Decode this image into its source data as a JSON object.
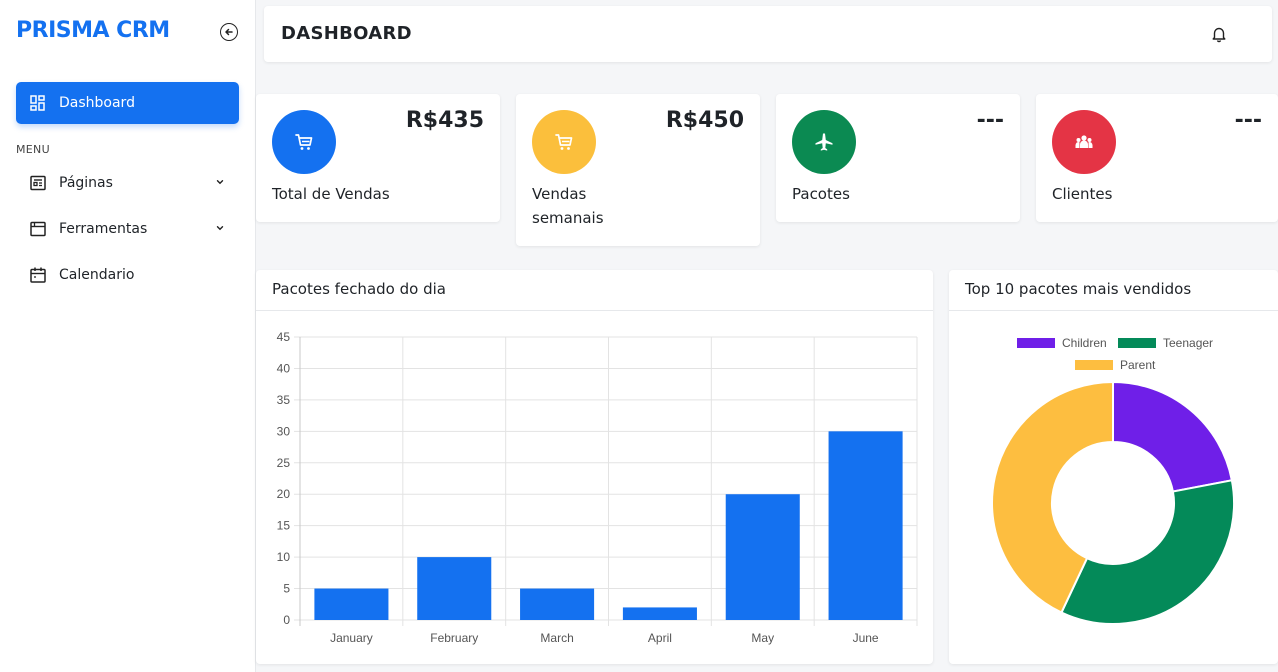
{
  "app": {
    "brand": "PRISMA CRM"
  },
  "sidebar": {
    "active": {
      "label": "Dashboard",
      "icon": "dashboard-icon"
    },
    "menu_header": "MENU",
    "items": [
      {
        "label": "Páginas",
        "icon": "pages-icon",
        "has_submenu": true
      },
      {
        "label": "Ferramentas",
        "icon": "window-icon",
        "has_submenu": true
      },
      {
        "label": "Calendario",
        "icon": "calendar-icon",
        "has_submenu": false
      }
    ]
  },
  "header": {
    "title": "DASHBOARD"
  },
  "cards": [
    {
      "label": "Total de Vendas",
      "value": "R$435",
      "icon": "cart-icon",
      "color": "#1471f0"
    },
    {
      "label": "Vendas semanais",
      "value": "R$450",
      "icon": "cart-icon",
      "color": "#fbbf3c"
    },
    {
      "label": "Pacotes",
      "value": "---",
      "icon": "airplane-icon",
      "color": "#0b8a52"
    },
    {
      "label": "Clientes",
      "value": "---",
      "icon": "users-icon",
      "color": "#e43445"
    }
  ],
  "bar_panel": {
    "title": "Pacotes fechado do dia"
  },
  "pie_panel": {
    "title": "Top 10 pacotes mais vendidos"
  },
  "colors": {
    "primary": "#1471f0",
    "children": "#6f1fe8",
    "teenager": "#048a59",
    "parent": "#fdbe40"
  },
  "chart_data": [
    {
      "type": "bar",
      "categories": [
        "January",
        "February",
        "March",
        "April",
        "May",
        "June"
      ],
      "values": [
        5,
        10,
        5,
        2,
        20,
        30
      ],
      "ylim": [
        0,
        45
      ],
      "yticks": [
        0,
        5,
        10,
        15,
        20,
        25,
        30,
        35,
        40,
        45
      ],
      "grid": true,
      "color": "#1471f0"
    },
    {
      "type": "pie",
      "donut": true,
      "legend_position": "top",
      "labels": [
        "Children",
        "Teenager",
        "Parent"
      ],
      "values": [
        22,
        35,
        43
      ],
      "colors": [
        "#6f1fe8",
        "#048a59",
        "#fdbe40"
      ]
    }
  ]
}
